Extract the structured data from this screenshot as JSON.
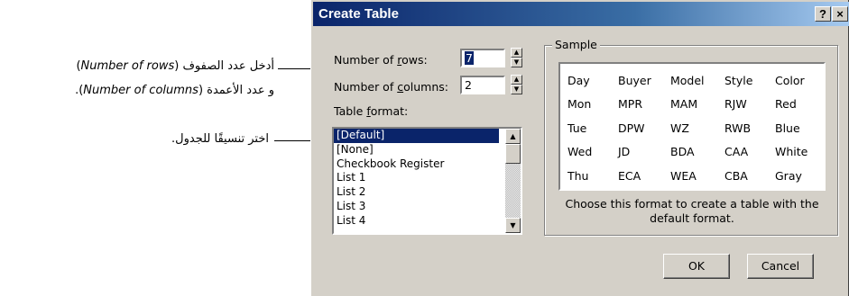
{
  "annotations": {
    "rows_cols_line1_ar": "أدخل عدد الصفوف (",
    "rows_cols_line1_en": "Number of rows",
    "rows_cols_line1_end": ")",
    "rows_cols_line2_ar": "و عدد الأعمدة (",
    "rows_cols_line2_en": "Number of columns",
    "rows_cols_line2_end": ").",
    "format_text": "اختر تنسيقًا للجدول."
  },
  "dialog": {
    "title": "Create Table",
    "help_btn": "?",
    "close_btn": "×",
    "rows_label_pre": "Number of ",
    "rows_label_u": "r",
    "rows_label_post": "ows:",
    "rows_value": "7",
    "cols_label_pre": "Number of ",
    "cols_label_u": "c",
    "cols_label_post": "olumns:",
    "cols_value": "2",
    "format_label_pre": "Table ",
    "format_label_u": "f",
    "format_label_post": "ormat:",
    "formats": [
      "[Default]",
      "[None]",
      "Checkbook Register",
      "List 1",
      "List 2",
      "List 3",
      "List 4"
    ],
    "selected_format_index": 0,
    "sample_legend": "Sample",
    "sample_rows": [
      [
        "Day",
        "Buyer",
        "Model",
        "Style",
        "Color"
      ],
      [
        "Mon",
        "MPR",
        "MAM",
        "RJW",
        "Red"
      ],
      [
        "Tue",
        "DPW",
        "WZ",
        "RWB",
        "Blue"
      ],
      [
        "Wed",
        "JD",
        "BDA",
        "CAA",
        "White"
      ],
      [
        "Thu",
        "ECA",
        "WEA",
        "CBA",
        "Gray"
      ]
    ],
    "sample_desc": "Choose this format to create a table with the default format.",
    "ok_label": "OK",
    "cancel_label": "Cancel"
  }
}
